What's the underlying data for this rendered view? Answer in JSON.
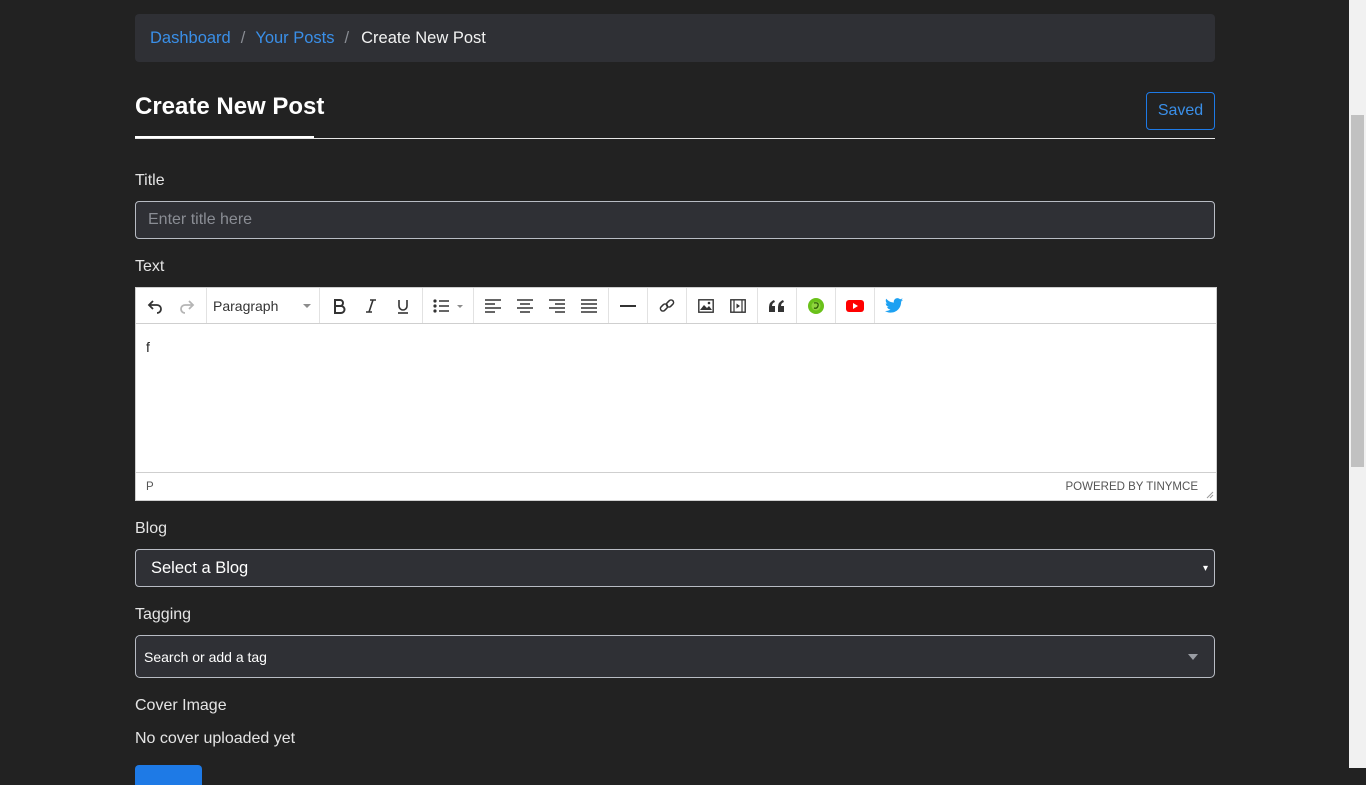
{
  "breadcrumb": {
    "items": [
      "Dashboard",
      "Your Posts"
    ],
    "current": "Create New Post",
    "separator": "/"
  },
  "header": {
    "title": "Create New Post",
    "status_button": "Saved"
  },
  "form": {
    "title_label": "Title",
    "title_placeholder": "Enter title here",
    "title_value": "",
    "text_label": "Text",
    "blog_label": "Blog",
    "blog_selected": "Select a Blog",
    "blog_arrow": "▾",
    "tagging_label": "Tagging",
    "tagging_placeholder": "Search or add a tag",
    "cover_label": "Cover Image",
    "cover_status": "No cover uploaded yet"
  },
  "editor": {
    "format_select": "Paragraph",
    "content": "f",
    "status_path": "P",
    "branding": "POWERED BY TINYMCE",
    "toolbar_icons": [
      "undo-icon",
      "redo-icon",
      "bold-icon",
      "italic-icon",
      "underline-icon",
      "bullet-list-icon",
      "align-left-icon",
      "align-center-icon",
      "align-right-icon",
      "align-justify-icon",
      "horizontal-rule-icon",
      "link-icon",
      "image-icon",
      "media-icon",
      "blockquote-icon",
      "giphy-icon",
      "youtube-icon",
      "twitter-icon"
    ]
  },
  "colors": {
    "background": "#222222",
    "panel": "#2f3035",
    "accent": "#1e7ae6",
    "link": "#3a8fe8",
    "youtube": "#ff0000",
    "twitter": "#1da1f2",
    "giphy": "#6ac11a"
  }
}
